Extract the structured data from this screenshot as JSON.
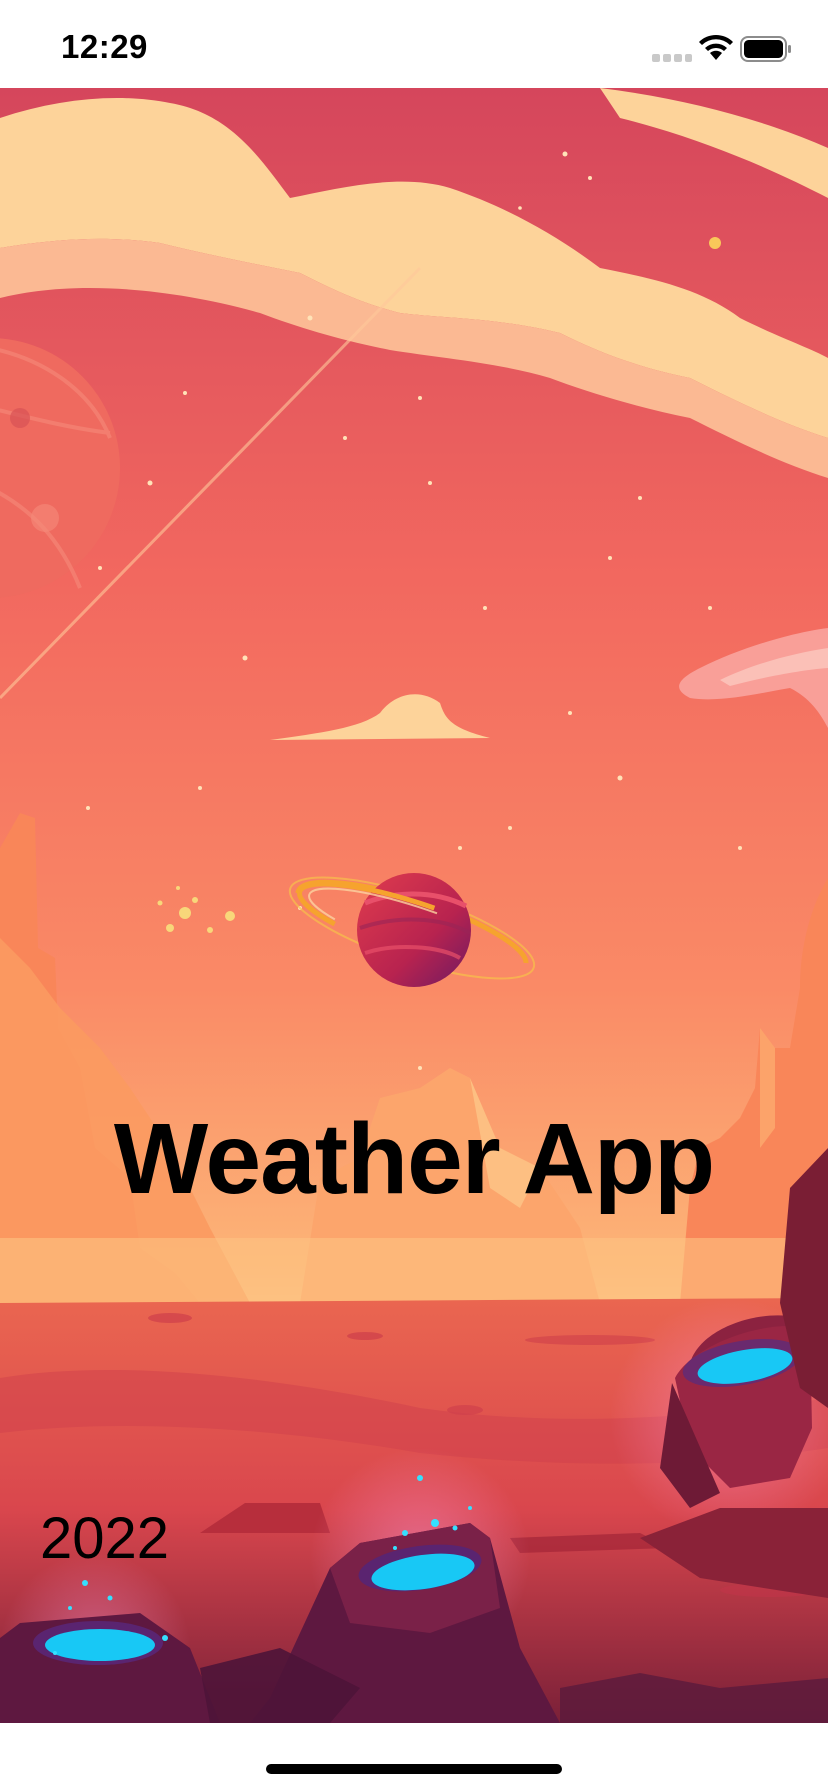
{
  "status_bar": {
    "time": "12:29",
    "icons": [
      "cellular-signal-icon",
      "wifi-icon",
      "battery-icon"
    ]
  },
  "splash": {
    "title": "Weather App",
    "year": "2022",
    "background": "mars-landscape-illustration",
    "emblem": "ringed-planet-illustration"
  },
  "colors": {
    "sky_top": "#d5465c",
    "sky_mid": "#f2685f",
    "sky_low": "#fcb477",
    "clouds": "#fdd39a",
    "ground": "#e0524e",
    "crater_glow": "#18c8f5",
    "planet": "#c8284e",
    "ring": "#f6a32e"
  }
}
